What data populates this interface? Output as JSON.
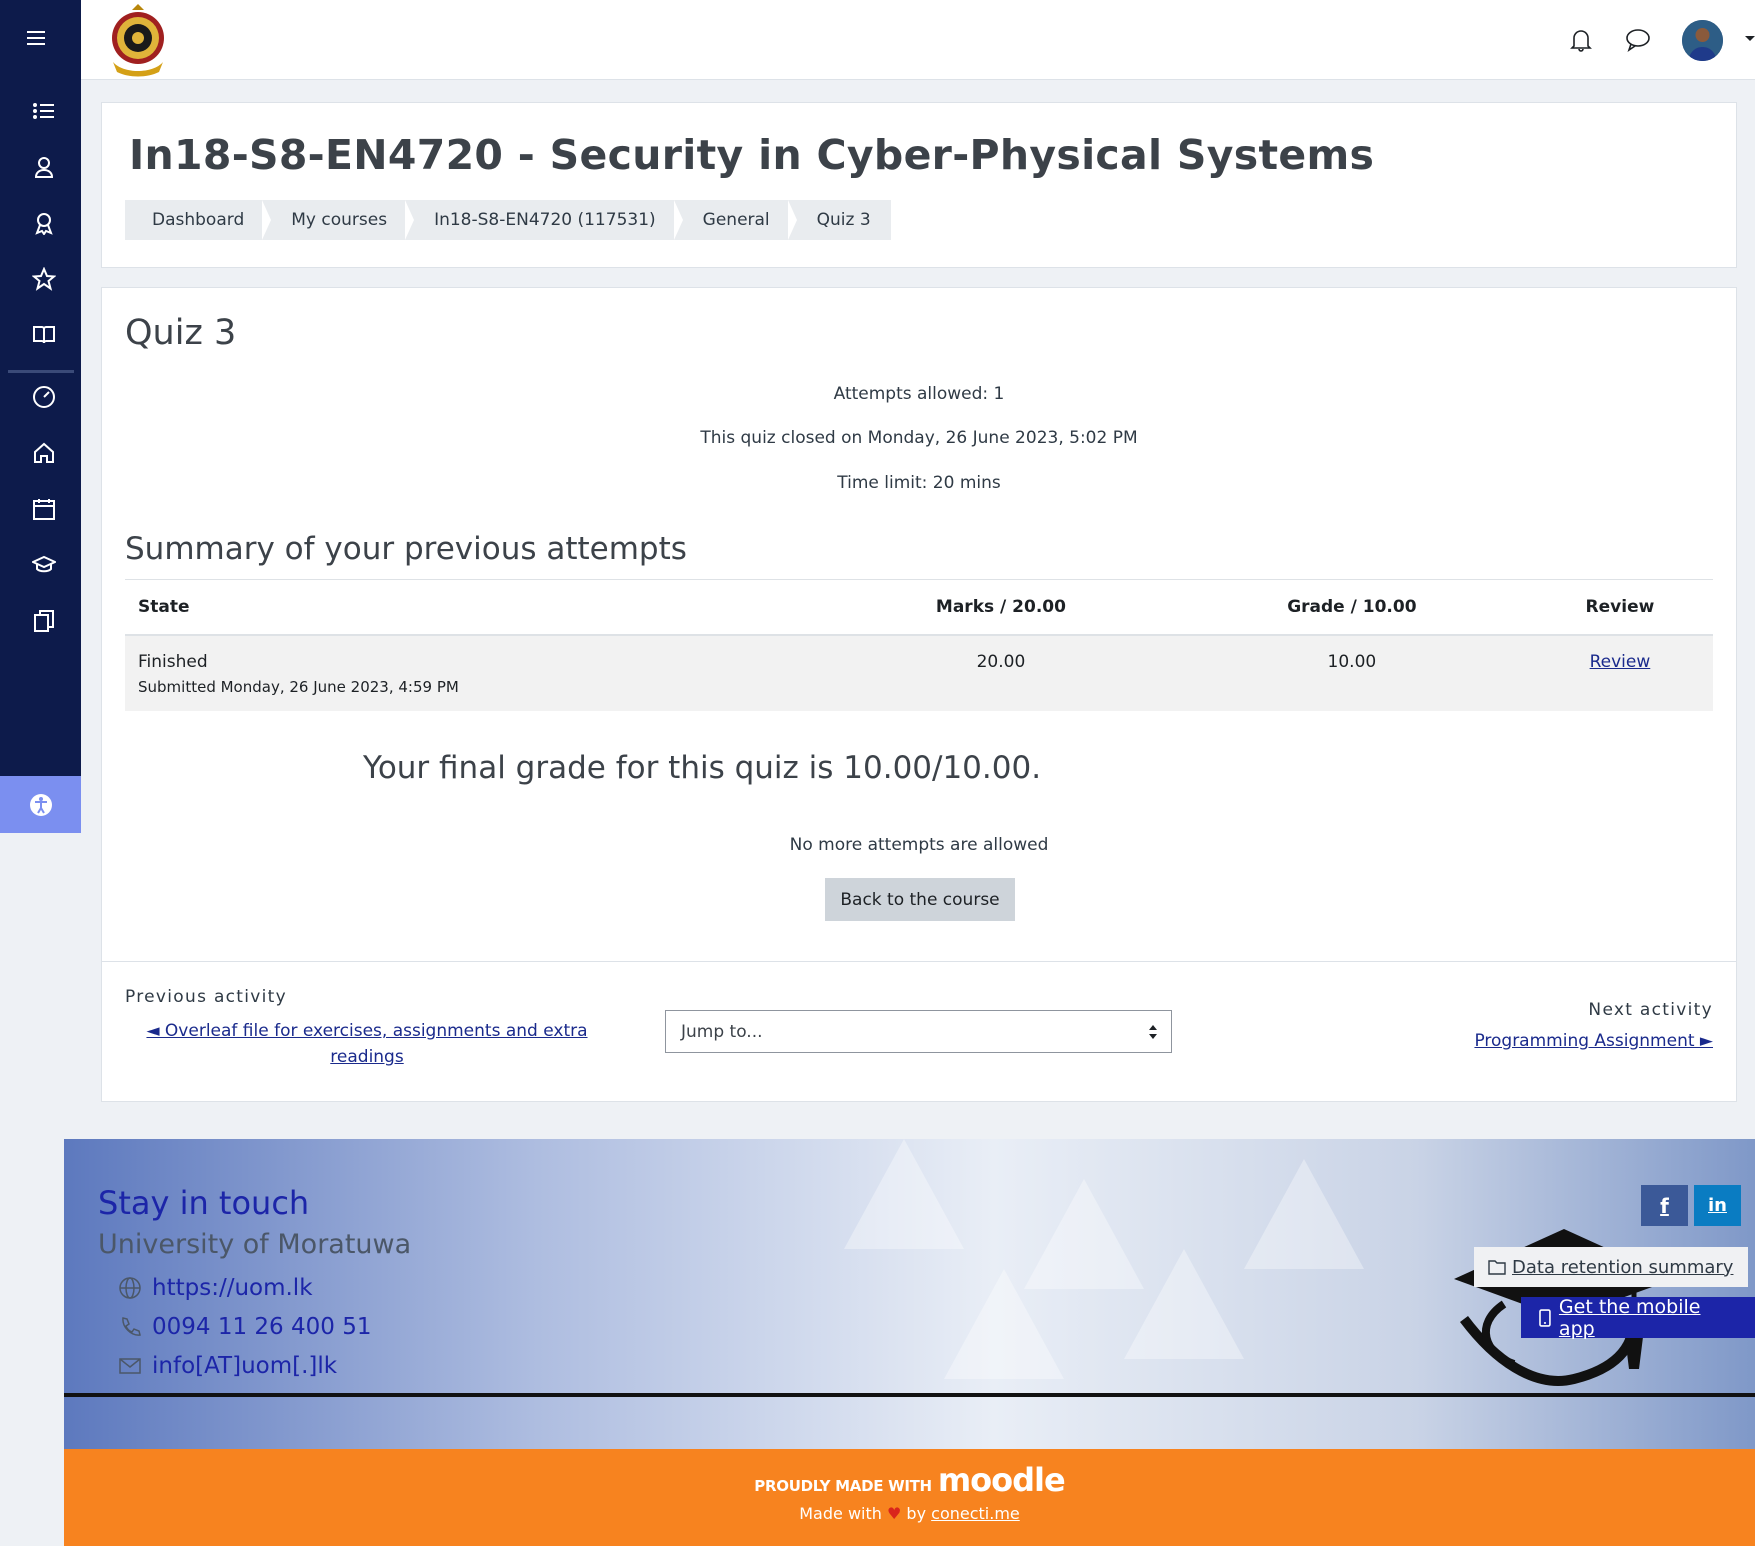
{
  "topbar": {
    "menu_icon": "hamburger-icon",
    "notifications_icon": "bell-icon",
    "messages_icon": "chat-icon"
  },
  "sidebar": {
    "items": [
      {
        "icon": "list-icon"
      },
      {
        "icon": "user-badge-icon"
      },
      {
        "icon": "award-icon"
      },
      {
        "icon": "star-icon"
      },
      {
        "icon": "book-icon"
      },
      {
        "icon": "dashboard-gauge-icon"
      },
      {
        "icon": "home-icon"
      },
      {
        "icon": "calendar-icon"
      },
      {
        "icon": "graduation-cap-icon"
      },
      {
        "icon": "files-icon"
      }
    ],
    "accessibility_icon": "accessibility-icon"
  },
  "header": {
    "title": "In18-S8-EN4720 - Security in Cyber-Physical Systems",
    "breadcrumb": [
      "Dashboard",
      "My courses",
      "In18-S8-EN4720 (117531)",
      "General",
      "Quiz 3"
    ]
  },
  "quiz": {
    "title": "Quiz 3",
    "attempts_allowed": "Attempts allowed: 1",
    "closed_on": "This quiz closed on Monday, 26 June 2023, 5:02 PM",
    "time_limit": "Time limit: 20 mins",
    "summary_title": "Summary of your previous attempts",
    "table": {
      "headers": [
        "State",
        "Marks / 20.00",
        "Grade / 10.00",
        "Review"
      ],
      "rows": [
        {
          "state": "Finished",
          "submitted": "Submitted Monday, 26 June 2023, 4:59 PM",
          "marks": "20.00",
          "grade": "10.00",
          "review": "Review"
        }
      ]
    },
    "final_grade": "Your final grade for this quiz is 10.00/10.00.",
    "no_more": "No more attempts are allowed",
    "back_button": "Back to the course"
  },
  "activity_nav": {
    "prev_label": "Previous activity",
    "prev_link": "◄ Overleaf file for exercises, assignments and extra readings",
    "jump_placeholder": "Jump to...",
    "next_label": "Next activity",
    "next_link": "Programming Assignment ►"
  },
  "footer": {
    "stay": "Stay in touch",
    "university": "University of Moratuwa",
    "website": "https://uom.lk",
    "phone": "0094 11 26 400 51",
    "email": "info[AT]uom[.]lk",
    "facebook": "f",
    "linkedin": "in",
    "data_retention": "Data retention summary",
    "mobile_app": "Get the mobile app",
    "proudly": "PROUDLY MADE WITH",
    "moodle": "moodle",
    "made_with_prefix": "Made with",
    "made_with_by": "by",
    "made_with_link": "conecti.me"
  },
  "colors": {
    "sidebar_bg": "#0d1b4b",
    "accent_link": "#1a2a8c",
    "footer_orange": "#f7831f",
    "accessibility_bg": "#7b8ff0"
  }
}
